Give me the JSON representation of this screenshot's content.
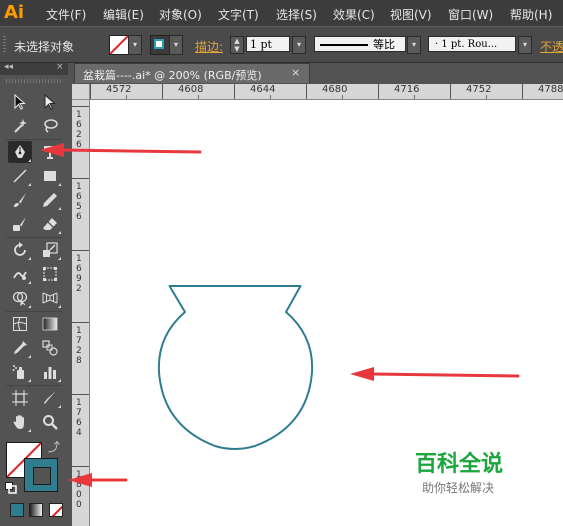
{
  "app": {
    "logo": "Ai"
  },
  "menu": [
    "文件(F)",
    "编辑(E)",
    "对象(O)",
    "文字(T)",
    "选择(S)",
    "效果(C)",
    "视图(V)",
    "窗口(W)",
    "帮助(H)"
  ],
  "control_bar": {
    "selection_label": "未选择对象",
    "stroke_label": "描边:",
    "stroke_weight": "1 pt",
    "profile_label": "等比",
    "brush": "· 1 pt. Rou...",
    "opacity_label": "不透"
  },
  "document": {
    "tab_title": "盆栽篇----.ai* @ 200% (RGB/预览)",
    "close_glyph": "×",
    "ruler_top": [
      "4572",
      "4608",
      "4644",
      "4680",
      "4716",
      "4752",
      "4788"
    ],
    "ruler_left": [
      "1626",
      "1656",
      "1692",
      "1728",
      "1764",
      "1800"
    ]
  },
  "tools": [
    "selection-tool",
    "direct-selection-tool",
    "magic-wand-tool",
    "lasso-tool",
    "pen-tool",
    "type-tool",
    "line-segment-tool",
    "rectangle-tool",
    "paintbrush-tool",
    "pencil-tool",
    "blob-brush-tool",
    "eraser-tool",
    "rotate-tool",
    "scale-tool",
    "warp-tool",
    "free-transform-tool",
    "shape-builder-tool",
    "perspective-grid-tool",
    "mesh-tool",
    "gradient-tool",
    "eyedropper-tool",
    "blend-tool",
    "symbol-sprayer-tool",
    "column-graph-tool",
    "artboard-tool",
    "slice-tool",
    "hand-tool",
    "zoom-tool"
  ],
  "selected_tool": "pen-tool",
  "colors": {
    "accent": "#ff9a00",
    "stroke": "#2f7d8e",
    "arrow": "#e8383d",
    "fill": "#ffffff",
    "none_slash": "#e02020"
  },
  "watermark": {
    "title": "百科全说",
    "subtitle": "助你轻松解决"
  }
}
